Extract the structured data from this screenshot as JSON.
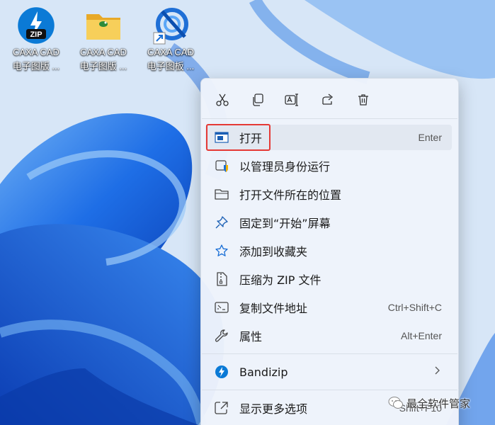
{
  "desktop_icons": [
    {
      "name": "zip-icon",
      "line1": "CAXA CAD",
      "line2": "电子图版 ..."
    },
    {
      "name": "folder-icon",
      "line1": "CAXA CAD",
      "line2": "电子图版 ..."
    },
    {
      "name": "caxa-shortcut-icon",
      "line1": "CAXA CAD",
      "line2": "电子图板 ..."
    }
  ],
  "quick_actions": [
    "cut-icon",
    "copy-icon",
    "rename-icon",
    "share-icon",
    "delete-icon"
  ],
  "menu": {
    "items": [
      {
        "label": "打开",
        "shortcut": "Enter",
        "icon": "open-app-icon"
      },
      {
        "label": "以管理员身份运行",
        "shortcut": "",
        "icon": "shield-icon"
      },
      {
        "label": "打开文件所在的位置",
        "shortcut": "",
        "icon": "folder-outline-icon"
      },
      {
        "label": "固定到“开始”屏幕",
        "shortcut": "",
        "icon": "pin-icon"
      },
      {
        "label": "添加到收藏夹",
        "shortcut": "",
        "icon": "star-icon"
      },
      {
        "label": "压缩为 ZIP 文件",
        "shortcut": "",
        "icon": "zip-archive-icon"
      },
      {
        "label": "复制文件地址",
        "shortcut": "Ctrl+Shift+C",
        "icon": "copy-path-icon"
      },
      {
        "label": "属性",
        "shortcut": "Alt+Enter",
        "icon": "wrench-icon"
      }
    ],
    "bandizip": {
      "label": "Bandizip",
      "icon": "bandizip-icon"
    },
    "more": {
      "label": "显示更多选项",
      "shortcut": "Shift+F10",
      "icon": "more-options-icon"
    }
  },
  "watermark": "最全软件管家",
  "colors": {
    "accent": "#0067c0",
    "highlight": "#e53935"
  }
}
